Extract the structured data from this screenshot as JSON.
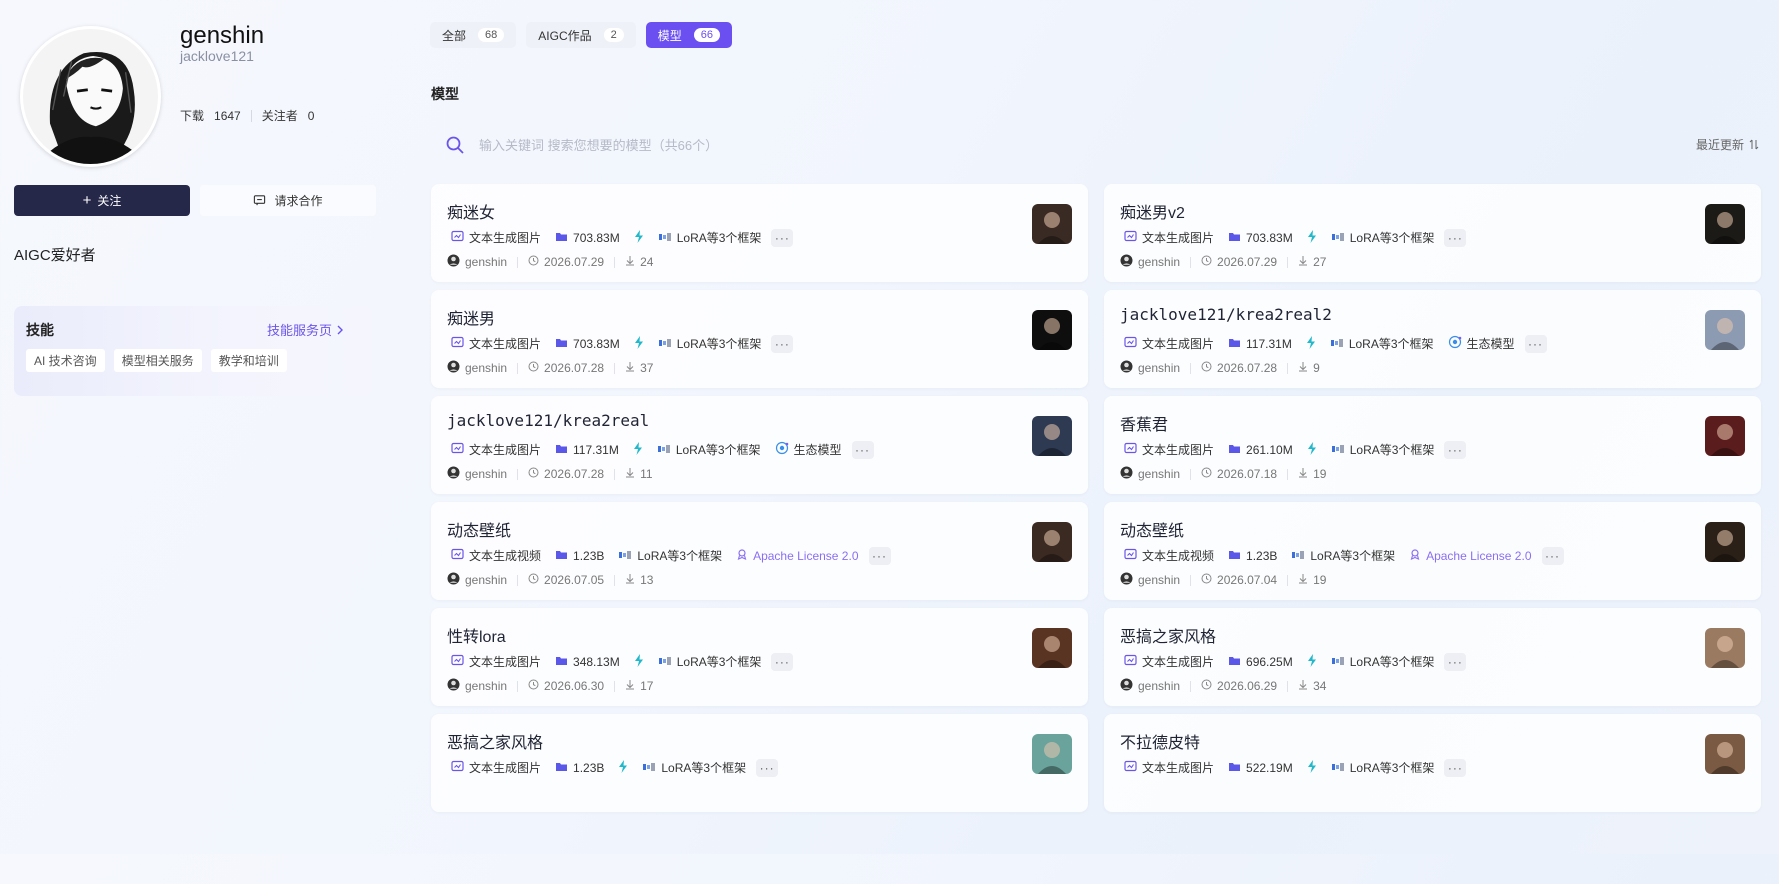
{
  "profile": {
    "username": "genshin",
    "handle": "jacklove121",
    "downloads_label": "下载",
    "downloads": "1647",
    "followers_label": "关注者",
    "followers": "0",
    "follow_label": "关注",
    "cooperate_label": "请求合作",
    "bio": "AIGC爱好者"
  },
  "skills": {
    "title": "技能",
    "link": "技能服务页",
    "tags": [
      "AI 技术咨询",
      "模型相关服务",
      "教学和培训"
    ]
  },
  "tabs": [
    {
      "label": "全部",
      "count": "68"
    },
    {
      "label": "AIGC作品",
      "count": "2"
    },
    {
      "label": "模型",
      "count": "66"
    }
  ],
  "section_title": "模型",
  "search": {
    "placeholder": "输入关键词 搜索您想要的模型（共66个）"
  },
  "sort_label": "最近更新",
  "cards": [
    {
      "name": "痴迷女",
      "type": "文本生成图片",
      "size": "703.83M",
      "framework": "LoRA等3个框架",
      "extra": "",
      "author": "genshin",
      "date": "2026.07.29",
      "downloads": "24",
      "thumb": "#3a2a24"
    },
    {
      "name": "痴迷男v2",
      "type": "文本生成图片",
      "size": "703.83M",
      "framework": "LoRA等3个框架",
      "extra": "",
      "author": "genshin",
      "date": "2026.07.29",
      "downloads": "27",
      "thumb": "#1c1a16"
    },
    {
      "name": "痴迷男",
      "type": "文本生成图片",
      "size": "703.83M",
      "framework": "LoRA等3个框架",
      "extra": "",
      "author": "genshin",
      "date": "2026.07.28",
      "downloads": "37",
      "thumb": "#0e0e0e"
    },
    {
      "name": "jacklove121/krea2real2",
      "type": "文本生成图片",
      "size": "117.31M",
      "framework": "LoRA等3个框架",
      "extra": "生态模型",
      "author": "genshin",
      "date": "2026.07.28",
      "downloads": "9",
      "thumb": "#8c9bb2"
    },
    {
      "name": "jacklove121/krea2real",
      "type": "文本生成图片",
      "size": "117.31M",
      "framework": "LoRA等3个框架",
      "extra": "生态模型",
      "author": "genshin",
      "date": "2026.07.28",
      "downloads": "11",
      "thumb": "#2d3a52"
    },
    {
      "name": "香蕉君",
      "type": "文本生成图片",
      "size": "261.10M",
      "framework": "LoRA等3个框架",
      "extra": "",
      "author": "genshin",
      "date": "2026.07.18",
      "downloads": "19",
      "thumb": "#5a1c1c"
    },
    {
      "name": "动态壁纸",
      "type": "文本生成视频",
      "size": "1.23B",
      "framework": "LoRA等3个框架",
      "license": "Apache License 2.0",
      "author": "genshin",
      "date": "2026.07.05",
      "downloads": "13",
      "thumb": "#3b2a22"
    },
    {
      "name": "动态壁纸",
      "type": "文本生成视频",
      "size": "1.23B",
      "framework": "LoRA等3个框架",
      "license": "Apache License 2.0",
      "author": "genshin",
      "date": "2026.07.04",
      "downloads": "19",
      "thumb": "#2a2018"
    },
    {
      "name": "性转lora",
      "type": "文本生成图片",
      "size": "348.13M",
      "framework": "LoRA等3个框架",
      "extra": "",
      "author": "genshin",
      "date": "2026.06.30",
      "downloads": "17",
      "thumb": "#5a3422"
    },
    {
      "name": "恶搞之家风格",
      "type": "文本生成图片",
      "size": "696.25M",
      "framework": "LoRA等3个框架",
      "extra": "",
      "author": "genshin",
      "date": "2026.06.29",
      "downloads": "34",
      "thumb": "#9b7a62"
    },
    {
      "name": "恶搞之家风格",
      "type": "文本生成图片",
      "size": "1.23B",
      "framework": "LoRA等3个框架",
      "extra": "",
      "author": "",
      "date": "",
      "downloads": "",
      "thumb": "#6aa39b"
    },
    {
      "name": "不拉德皮特",
      "type": "文本生成图片",
      "size": "522.19M",
      "framework": "LoRA等3个框架",
      "extra": "",
      "author": "",
      "date": "",
      "downloads": "",
      "thumb": "#7a5a42"
    }
  ]
}
